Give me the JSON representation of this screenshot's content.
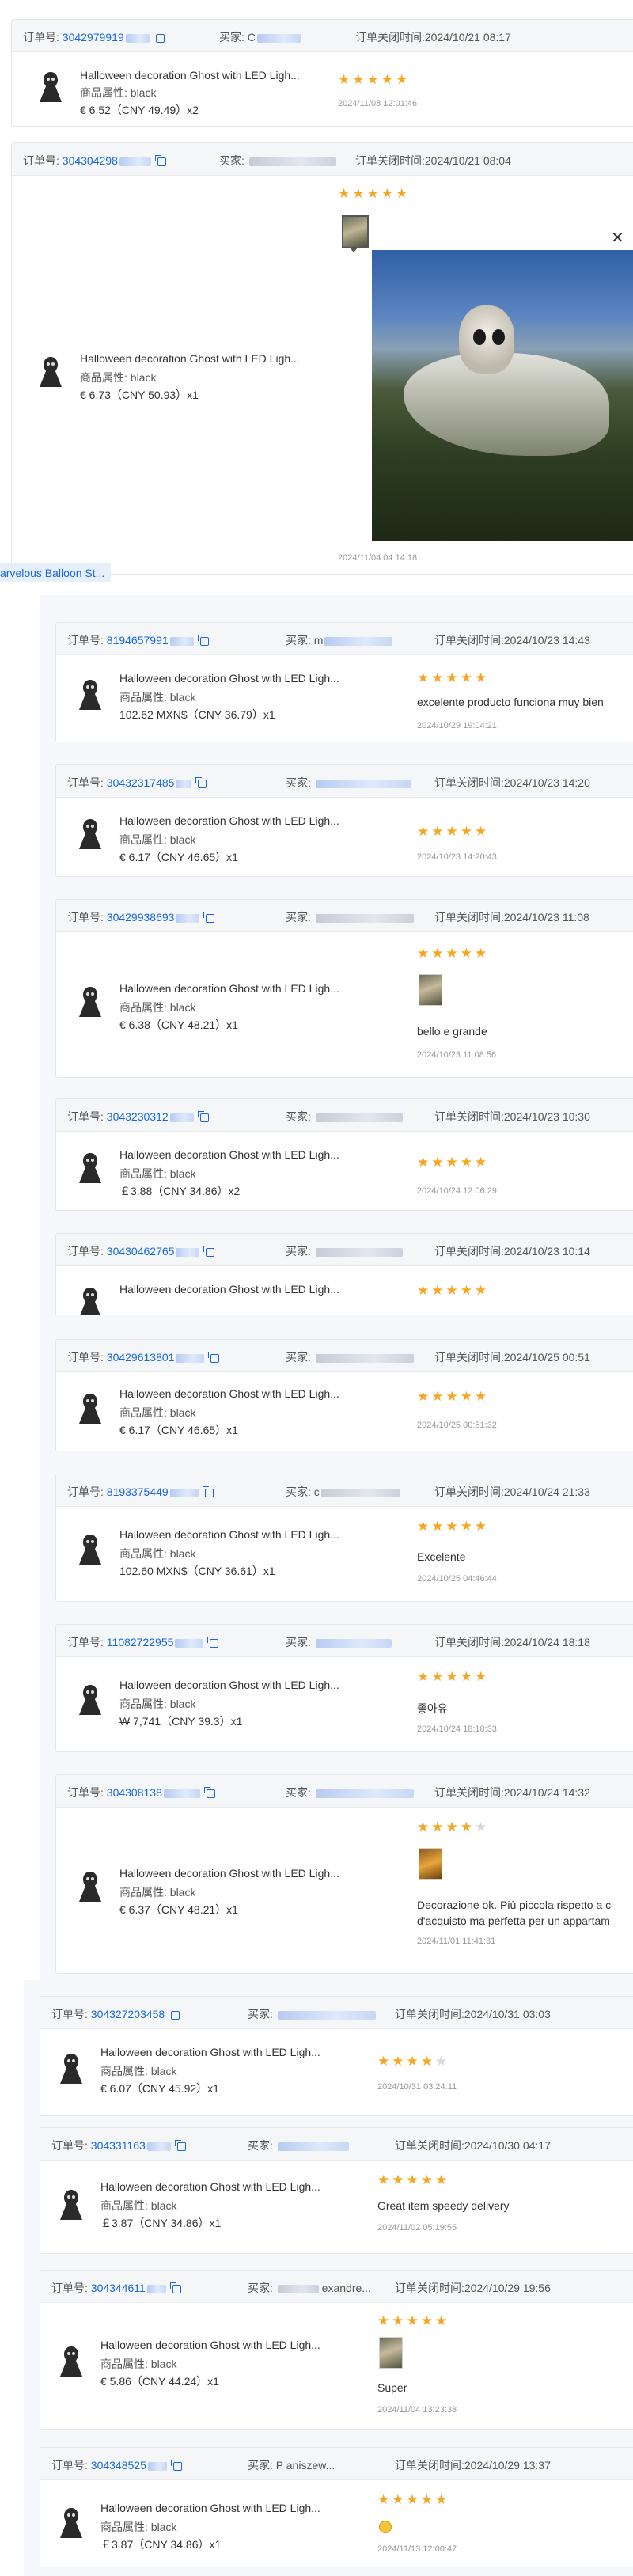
{
  "labels": {
    "order_no": "订单号:",
    "buyer": "买家:",
    "close_time_prefix": "订单关闭时间:",
    "attr_prefix": "商品属性:"
  },
  "product": {
    "title": "Halloween decoration Ghost with LED Ligh...",
    "attr_value": "black"
  },
  "floating_tag": "arvelous Balloon St...",
  "orders": [
    {
      "order_no": "3042979919",
      "buyer": "C",
      "close_time": "2024/10/21 08:17",
      "price": "€ 6.52（CNY 49.49）x2",
      "stars": 5,
      "review": "",
      "review_date": "2024/11/08 12:01:46",
      "has_image": false
    },
    {
      "order_no": "304304298",
      "buyer": "",
      "close_time": "2024/10/21 08:04",
      "price": "€ 6.73（CNY 50.93）x1",
      "stars": 5,
      "review": "",
      "review_date": "2024/11/04 04:14:18",
      "has_image": true
    },
    {
      "order_no": "8194657991",
      "buyer": "m",
      "close_time": "2024/10/23 14:43",
      "price": "102.62 MXN$（CNY 36.79）x1",
      "stars": 5,
      "review": "excelente producto funciona muy bien",
      "review_date": "2024/10/29 19:04:21",
      "has_image": false
    },
    {
      "order_no": "30432317485",
      "buyer": "",
      "close_time": "2024/10/23 14:20",
      "price": "€ 6.17（CNY 46.65）x1",
      "stars": 5,
      "review": "",
      "review_date": "2024/10/23 14:20:43",
      "has_image": false
    },
    {
      "order_no": "30429938693",
      "buyer": "",
      "close_time": "2024/10/23 11:08",
      "price": "€ 6.38（CNY 48.21）x1",
      "stars": 5,
      "review": "bello e grande",
      "review_date": "2024/10/23 11:08:56",
      "has_image": true
    },
    {
      "order_no": "3043230312",
      "buyer": "",
      "close_time": "2024/10/23 10:30",
      "price": "￡3.88（CNY 34.86）x2",
      "stars": 5,
      "review": "",
      "review_date": "2024/10/24 12:06:29",
      "has_image": false
    },
    {
      "order_no": "30430462765",
      "buyer": "",
      "close_time": "2024/10/23 10:14",
      "price": "",
      "stars": 5,
      "review": "",
      "review_date": "",
      "has_image": false
    },
    {
      "order_no": "30429613801",
      "buyer": "",
      "close_time": "2024/10/25 00:51",
      "price": "€ 6.17（CNY 46.65）x1",
      "stars": 5,
      "review": "",
      "review_date": "2024/10/25 00:51:32",
      "has_image": false
    },
    {
      "order_no": "8193375449",
      "buyer": "c",
      "close_time": "2024/10/24 21:33",
      "price": "102.60 MXN$（CNY 36.61）x1",
      "stars": 5,
      "review": "Excelente",
      "review_date": "2024/10/25 04:46:44",
      "has_image": false
    },
    {
      "order_no": "11082722955",
      "buyer": "",
      "close_time": "2024/10/24 18:18",
      "price": "₩ 7,741（CNY 39.3）x1",
      "stars": 5,
      "review": "좋아유",
      "review_date": "2024/10/24 18:18:33",
      "has_image": false
    },
    {
      "order_no": "304308138",
      "buyer": "",
      "close_time": "2024/10/24 14:32",
      "price": "€ 6.37（CNY 48.21）x1",
      "stars": 4,
      "review": "Decorazione ok. Più piccola rispetto a c",
      "review2": "d'acquisto ma perfetta per un appartam",
      "review_date": "2024/11/01 11:41:31",
      "has_image": true
    },
    {
      "order_no": "304327203458",
      "buyer": "",
      "close_time": "2024/10/31 03:03",
      "price": "€ 6.07（CNY 45.92）x1",
      "stars": 4,
      "review": "",
      "review_date": "2024/10/31 03:24:11",
      "has_image": false
    },
    {
      "order_no": "304331163",
      "buyer": "",
      "close_time": "2024/10/30 04:17",
      "price": "￡3.87（CNY 34.86）x1",
      "stars": 5,
      "review": "Great item speedy delivery",
      "review_date": "2024/11/02 05:19:55",
      "has_image": false
    },
    {
      "order_no": "304344611",
      "buyer": "exandre...",
      "close_time": "2024/10/29 19:56",
      "price": "€ 5.86（CNY 44.24）x1",
      "stars": 5,
      "review": "Super",
      "review_date": "2024/11/04 13:23:38",
      "has_image": true
    },
    {
      "order_no": "304348525",
      "buyer": "P aniszew...",
      "close_time": "2024/10/29 13:37",
      "price": "￡3.87（CNY 34.86）x1",
      "stars": 5,
      "review": "",
      "review_date": "2024/11/13 12:00:47",
      "has_image": false
    }
  ]
}
